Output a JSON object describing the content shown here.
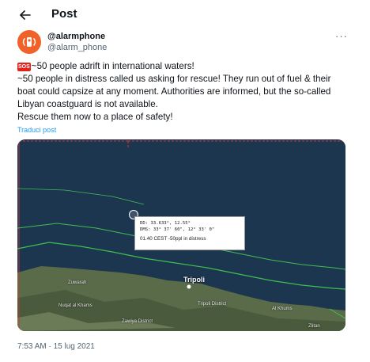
{
  "header": {
    "back_icon": "arrow-left-icon",
    "title": "Post"
  },
  "author": {
    "avatar_icon": "alarm-phone-logo",
    "display_name": "@alarmphone",
    "handle": "@alarm_phone",
    "more_icon": "more-horizontal-icon",
    "more_label": "···"
  },
  "tweet": {
    "sos_badge": "SOS",
    "lines": [
      "~50 people adrift in international waters!",
      "~50 people in distress called us asking for rescue! They run out of fuel & their boat could capsize at any moment. Authorities are informed, but the so-called Libyan coastguard is not available.",
      "Rescue them now to a place of safety!"
    ],
    "translate_label": "Traduci post"
  },
  "map": {
    "popup": {
      "dd": "DD: 33.633°, 12.55°",
      "dms": "DMS: 33° 37' 60\", 12° 33' 0\"",
      "description": "01.40 CEST -50ppl in distress"
    },
    "labels": {
      "zuwarah": "Zuwarah",
      "nuqat": "Nuqat al Khams",
      "zawiya": "Zawiya District",
      "tripoli": "Tripoli",
      "tripoli_district": "Tripoli District",
      "al_khums": "Al Khums",
      "zlitan": "Zlitan"
    },
    "colors": {
      "sea": "#1c3650",
      "sar_boundary": "#e03030",
      "territorial_line": "#3fbf4f"
    }
  },
  "timestamp": "7:53 AM · 15 lug 2021"
}
